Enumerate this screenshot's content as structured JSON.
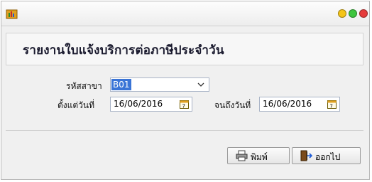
{
  "report": {
    "title": "รายงานใบแจ้งบริการต่อภาษีประจำวัน"
  },
  "form": {
    "branch_label": "รหัสสาขา",
    "branch_value": "B01",
    "start_date_label": "ตั้งแต่วันที่",
    "start_date_value": "16/06/2016",
    "end_date_label": "จนถึงวันที่",
    "end_date_value": "16/06/2016"
  },
  "buttons": {
    "print_label": "พิมพ์",
    "exit_label": "ออกไป"
  },
  "window_buttons": {
    "minimize_color": "#f5c518",
    "maximize_color": "#3fc53f",
    "close_color": "#e63c3c"
  },
  "icons": {
    "app": "folder-chart-icon",
    "calendar": "calendar-icon",
    "print": "printer-icon",
    "exit": "exit-door-icon"
  }
}
